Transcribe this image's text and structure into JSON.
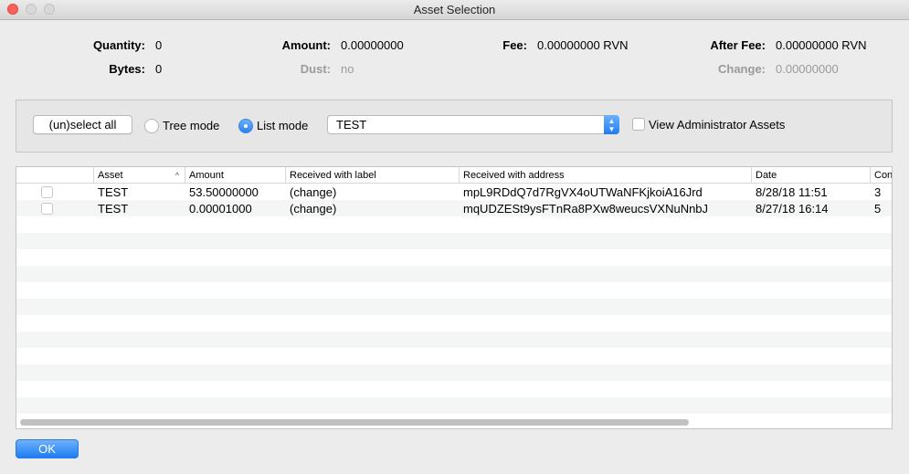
{
  "window": {
    "title": "Asset Selection"
  },
  "stats": {
    "quantity_label": "Quantity:",
    "quantity_value": "0",
    "bytes_label": "Bytes:",
    "bytes_value": "0",
    "amount_label": "Amount:",
    "amount_value": "0.00000000",
    "dust_label": "Dust:",
    "dust_value": "no",
    "fee_label": "Fee:",
    "fee_value": "0.00000000 RVN",
    "after_fee_label": "After Fee:",
    "after_fee_value": "0.00000000 RVN",
    "change_label": "Change:",
    "change_value": "0.00000000"
  },
  "controls": {
    "unselect_all_label": "(un)select all",
    "tree_mode_label": "Tree mode",
    "list_mode_label": "List mode",
    "mode_selected": "List mode",
    "asset_select_value": "TEST",
    "view_admin_label": "View Administrator Assets",
    "view_admin_checked": false
  },
  "table": {
    "columns": [
      "",
      "Asset",
      "Amount",
      "Received with label",
      "Received with address",
      "Date",
      "Con"
    ],
    "sort_column": "Asset",
    "rows": [
      {
        "asset": "TEST",
        "amount": "53.50000000",
        "label": "(change)",
        "address": "mpL9RDdQ7d7RgVX4oUTWaNFKjkoiA16Jrd",
        "date": "8/28/18 11:51",
        "conf": "3"
      },
      {
        "asset": "TEST",
        "amount": "0.00001000",
        "label": "(change)",
        "address": "mqUDZESt9ysFTnRa8PXw8weucsVXNuNnbJ",
        "date": "8/27/18 16:14",
        "conf": "5"
      }
    ]
  },
  "ok_label": "OK",
  "colors": {
    "accent": "#2a82f2",
    "close": "#fc605c"
  }
}
